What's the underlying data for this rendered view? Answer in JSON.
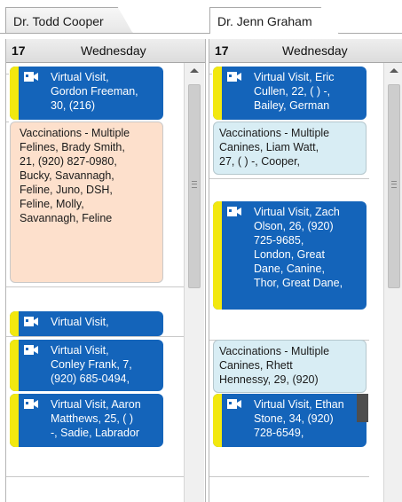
{
  "tabs": [
    {
      "label": "Dr. Todd Cooper"
    },
    {
      "label": "Dr. Jenn Graham"
    }
  ],
  "columns": [
    {
      "day_number": "17",
      "day_name": "Wednesday",
      "appointments": [
        {
          "type": "virtual",
          "text": "Virtual Visit,\nGordon Freeman,\n30, (216)"
        },
        {
          "type": "vaccination",
          "text": "Vaccinations - Multiple\nFelines, Brady Smith,\n21, (920) 827-0980,\nBucky, Savannagh,\nFeline, Juno, DSH,\nFeline, Molly,\nSavannagh, Feline"
        },
        {
          "type": "virtual",
          "text": "Virtual Visit,"
        },
        {
          "type": "virtual",
          "text": "Virtual Visit,\nConley Frank, 7,\n(920) 685-0494,"
        },
        {
          "type": "virtual",
          "text": "Virtual Visit, Aaron\nMatthews, 25, (  )\n-, Sadie, Labrador"
        }
      ]
    },
    {
      "day_number": "17",
      "day_name": "Wednesday",
      "appointments": [
        {
          "type": "virtual",
          "text": "Virtual Visit, Eric\nCullen, 22, (  )   -,\nBailey, German"
        },
        {
          "type": "vaccination",
          "text": "Vaccinations - Multiple\nCanines, Liam Watt,\n27, (  )   -, Cooper,"
        },
        {
          "type": "virtual",
          "text": "Virtual Visit, Zach\nOlson, 26, (920)\n725-9685,\nLondon, Great\nDane, Canine,\nThor, Great Dane,"
        },
        {
          "type": "vaccination",
          "text": "Vaccinations - Multiple\nCanines, Rhett\nHennessy, 29, (920)"
        },
        {
          "type": "virtual",
          "text": "Virtual Visit, Ethan\nStone, 34, (920)\n728-6549,"
        }
      ]
    }
  ],
  "colors": {
    "virtual": "#1464ba",
    "vaccination_feline": "#fde0cc",
    "vaccination_canine": "#d8edf4",
    "status_stripe": "#f2e80f"
  },
  "icons": {
    "virtual": "video-camera-icon"
  }
}
